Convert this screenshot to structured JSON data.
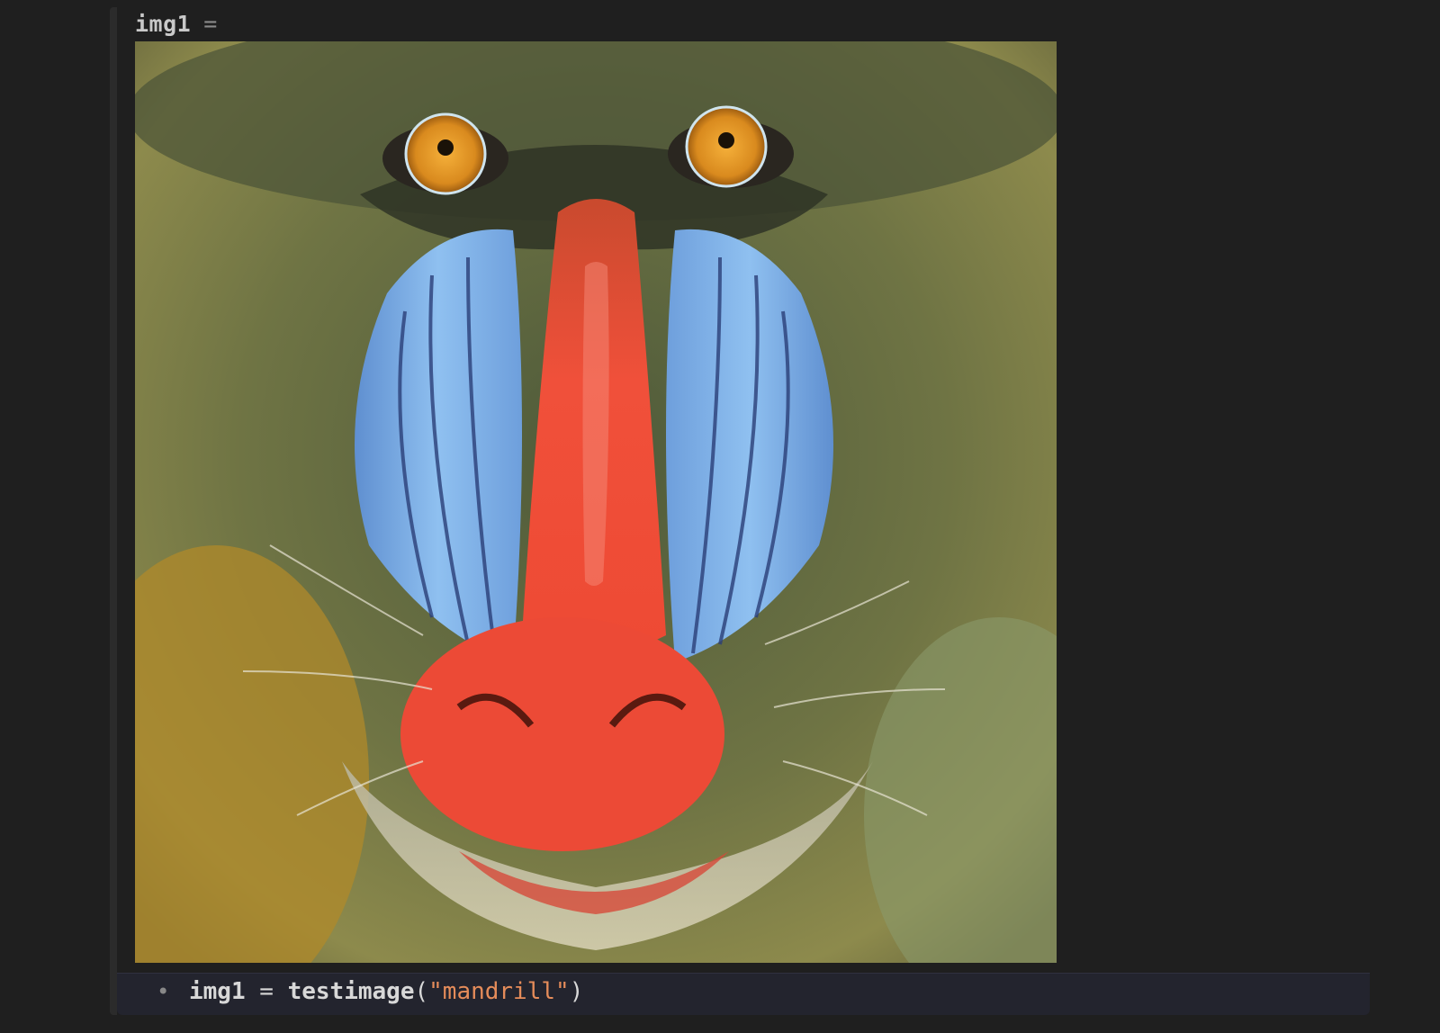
{
  "output": {
    "variable": "img1",
    "equals": "="
  },
  "image": {
    "subject": "mandrill",
    "icon": "mandrill-image"
  },
  "code": {
    "bullet": "•",
    "var": "img1",
    "assign": " = ",
    "func": "testimage",
    "open": "(",
    "arg": "\"mandrill\"",
    "close": ")"
  },
  "colors": {
    "background": "#1f1f1f",
    "code_bg": "#23242e",
    "string": "#e58c5a",
    "text": "#d8d8d8"
  }
}
